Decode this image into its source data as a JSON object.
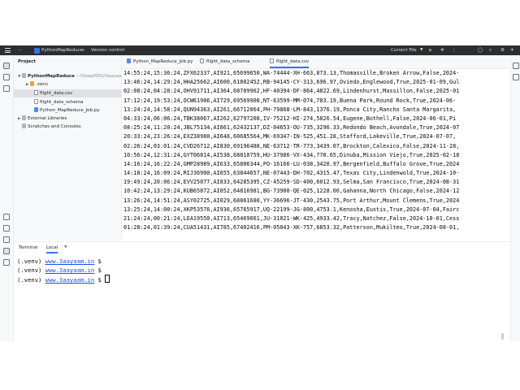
{
  "toolbar": {
    "project_badge": "PM",
    "project_name": "PythonMapReduce",
    "version_control": "Version control",
    "current_file": "Current File"
  },
  "project_panel": {
    "title": "Project",
    "root": {
      "label": "PythonMapReduce",
      "path": "~/DeepHDD/3aayaa"
    },
    "items": [
      {
        "label": ".venv"
      },
      {
        "label": "flight_data.csv"
      },
      {
        "label": "flight_data_schema"
      },
      {
        "label": "Python_MapReduce_Job.py"
      },
      {
        "label": "External Libraries"
      },
      {
        "label": "Scratches and Consoles"
      }
    ]
  },
  "editor": {
    "tabs": [
      {
        "label": "Python_MapReduce_Job.py"
      },
      {
        "label": "flight_data_schema"
      },
      {
        "label": "flight_data.csv"
      }
    ],
    "lines": [
      "14:55:24,15:36:24,ZFX62337,AI921,65699650,WA-74444-XH-663,873.13,Thomasville,Broken Arrow,False,2024-",
      "13:46:24,14:29:24,HHA25662,AI600,61802452,RB-94145-CY-313,696.97,Oviedo,Englewood,True,2025-01-09,Gul",
      "02:08:24,04:28:24,OHV91711,AI364,68709962,HF-40394-DF-864,4822.69,Lindenhurst,Massillon,False,2025-01",
      "17:12:24,19:53:24,OCW61906,AI729,69569900,NT-63599-MM-074,783.19,Buena Park,Round Rock,True,2024-06-",
      "13:24:24,14:58:24,QUN94363,AI261,66712064,PH-79868-LM-843,1376.19,Ponca City,Rancho Santa Margarita,",
      "04:33:24,06:06:24,TBK38067,AI262,62797208,IV-75212-HI-274,5826.54,Eugene,Bothell,False,2024-06-01,Pi",
      "08:25:24,11:20:24,JBL75134,AI861,62432137,DZ-04653-OU-735,3296.33,Redondo Beach,Avondale,True,2024-07",
      "20:33:24,23:26:24,EXZ38980,AI648,60685564,MK-69347-IN-525,451.28,Stafford,Lakeville,True,2024-07-07,",
      "02:26:24,03:01:24,CVD26712,AI830,69196488,NE-63712-TR-773,3439.07,Brockton,Calexico,False,2024-11-28,",
      "10:56:24,12:31:24,GYT06814,AI538,68810759,HU-37986-VX-434,770.65,Dinuba,Mission Viejo,True,2025-02-18",
      "14:16:24,16:22:24,GMP28989,AI633,65806344,PO-16166-LU-038,3420.97,Bergenfield,Buffalo Grove,True,2024",
      "14:18:24,16:09:24,RIJ36900,AI655,63844657,NE-07443-DH-702,4315.47,Texas City,Lindenwold,True,2024-10-",
      "19:49:24,20:06:24,EVV25077,AI833,64285395,CZ-45259-SD-400,6012.93,Selma,San Francisco,True,2024-08-31",
      "10:42:24,13:29:24,KUB65872,AI052,64816981,BG-73900-QE-025,1228.06,Gahanna,North Chicago,False,2024-12",
      "13:26:24,14:51:24,ASY02725,AI029,68861680,YY-36696-JT-430,2543.75,Port Arthur,Mount Clemens,True,2024",
      "13:25:24,14:00:24,XKP53576,AI936,65765917,UQ-22199-JG-800,4753.1,Kenosha,Eustis,True,2024-07-04,Fairc",
      "21:24:24,00:21:24,LEA19550,AI713,65469061,JU-31021-WK-425,4933.42,Tracy,Natchez,False,2024-10-01,Cess",
      "01:28:24,01:39:24,CUA51431,AI785,67402416,PM-05043-XK-757,6853.32,Patterson,Mukilteo,True,2024-08-01,"
    ]
  },
  "terminal": {
    "tabs": [
      {
        "label": "Terminal"
      },
      {
        "label": "Local"
      }
    ],
    "prompt_prefix": "(.venv) ",
    "host": "www.3aayaam.in",
    "prompt_suffix": " $"
  },
  "colors": {
    "accent": "#3574f0",
    "toolbar_bg": "#2b2d30",
    "link": "#1750eb"
  }
}
